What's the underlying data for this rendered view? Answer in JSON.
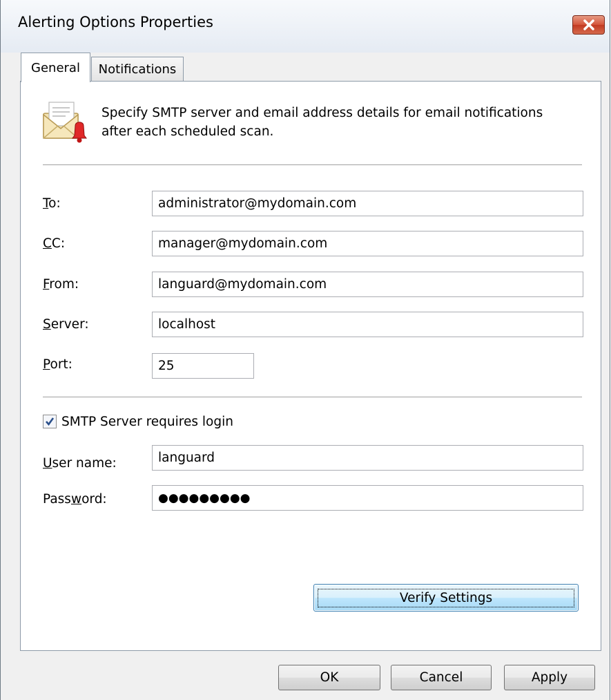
{
  "window": {
    "title": "Alerting Options Properties"
  },
  "tabs": [
    {
      "label": "General",
      "active": true
    },
    {
      "label": "Notifications",
      "active": false
    }
  ],
  "description": {
    "line1": "Specify SMTP server and email address details for email notifications",
    "line2": "after each scheduled scan."
  },
  "fields": {
    "to": {
      "label_key": "T",
      "label_rest": "o:",
      "value": "administrator@mydomain.com"
    },
    "cc": {
      "label_key": "C",
      "label_rest": "C:",
      "value": "manager@mydomain.com"
    },
    "from": {
      "label_key": "F",
      "label_rest": "rom:",
      "value": "languard@mydomain.com"
    },
    "server": {
      "label_key": "S",
      "label_rest": "erver:",
      "value": "localhost"
    },
    "port": {
      "label_key": "P",
      "label_rest": "ort:",
      "value": "25"
    }
  },
  "login": {
    "checkbox_label": "SMTP Server requires login",
    "checked": true,
    "username": {
      "label_key": "U",
      "label_rest": "ser name:",
      "value": "languard"
    },
    "password": {
      "label_pre": "Pass",
      "label_key": "w",
      "label_rest": "ord:",
      "value": "●●●●●●●●●"
    }
  },
  "buttons": {
    "verify": "Verify Settings",
    "ok": "OK",
    "cancel": "Cancel",
    "apply": "Apply"
  },
  "colors": {
    "accent": "#3c7fb1",
    "close": "#c23a22"
  }
}
